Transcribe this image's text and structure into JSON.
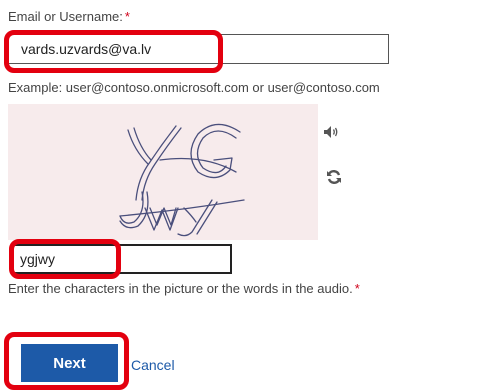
{
  "form": {
    "email_label": "Email or Username:",
    "required_mark": "*",
    "email_value": "vards.uzvards@va.lv",
    "email_hint": "Example: user@contoso.onmicrosoft.com or user@contoso.com",
    "captcha_value": "ygjwy",
    "captcha_hint": "Enter the characters in the picture or the words in the audio.",
    "next_label": "Next",
    "cancel_label": "Cancel"
  },
  "icons": {
    "audio": "speaker-icon",
    "refresh": "refresh-icon"
  },
  "colors": {
    "primary": "#1d5aa8",
    "required": "#d0021b",
    "highlight": "#e3000f",
    "captcha_bg": "#f7ebec"
  }
}
